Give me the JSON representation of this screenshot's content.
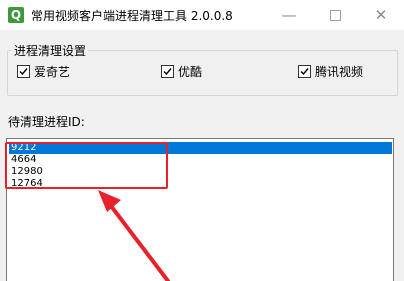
{
  "window": {
    "title": "常用视频客户端进程清理工具 2.0.0.8",
    "icon_letter": "Q",
    "controls": {
      "minimize": "—",
      "close": "✕"
    }
  },
  "settings_group": {
    "legend": "进程清理设置",
    "checkboxes": [
      {
        "label": "爱奇艺",
        "checked": true
      },
      {
        "label": "优酷",
        "checked": true
      },
      {
        "label": "腾讯视频",
        "checked": true
      }
    ]
  },
  "process_list": {
    "label": "待清理进程ID:",
    "items": [
      "9212",
      "4664",
      "12980",
      "12764"
    ],
    "selected_index": 0
  },
  "annotation_colors": {
    "highlight": "#e8202a",
    "selection": "#0078d7"
  }
}
